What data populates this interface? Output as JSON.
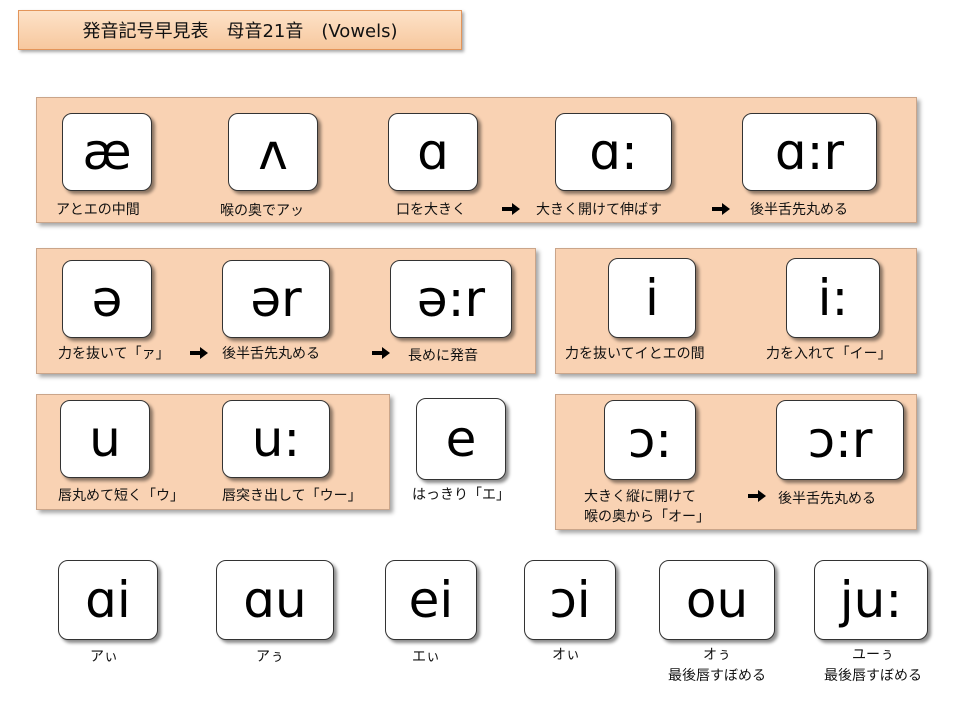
{
  "title": "発音記号早見表　母音21音　(Vowels)",
  "arrow_glyph": "arrow-right-icon",
  "row1": {
    "symbols": [
      "æ",
      "ʌ",
      "ɑ",
      "ɑ:",
      "ɑ:r"
    ],
    "labels": [
      "アとエの中間",
      "喉の奥でアッ",
      "口を大きく",
      "大きく開けて伸ばす",
      "後半舌先丸める"
    ]
  },
  "row2a": {
    "symbols": [
      "ə",
      "ər",
      "ə:r"
    ],
    "labels": [
      "力を抜いて「ァ」",
      "後半舌先丸める",
      "長めに発音"
    ]
  },
  "row2b": {
    "symbols": [
      "i",
      "i:"
    ],
    "labels": [
      "力を抜いてイとエの間",
      "力を入れて「イー」"
    ]
  },
  "row3a": {
    "symbols": [
      "u",
      "u:"
    ],
    "labels": [
      "唇丸めて短く「ウ」",
      "唇突き出して「ウー」"
    ]
  },
  "row3e": {
    "symbol": "e",
    "label": "はっきり「エ」"
  },
  "row3b": {
    "symbols": [
      "ɔ:",
      "ɔ:r"
    ],
    "label_line1": "大きく縦に開けて",
    "label_line2": "喉の奥から「オー」",
    "label2": "後半舌先丸める"
  },
  "diphthongs": {
    "symbols": [
      "ɑi",
      "ɑu",
      "ei",
      "ɔi",
      "ou",
      "ju:"
    ],
    "labels": [
      "アぃ",
      "アぅ",
      "エぃ",
      "オぃ",
      "オぅ",
      "ユーぅ"
    ],
    "sub_labels": [
      "最後唇すぼめる",
      "最後唇すぼめる"
    ]
  }
}
